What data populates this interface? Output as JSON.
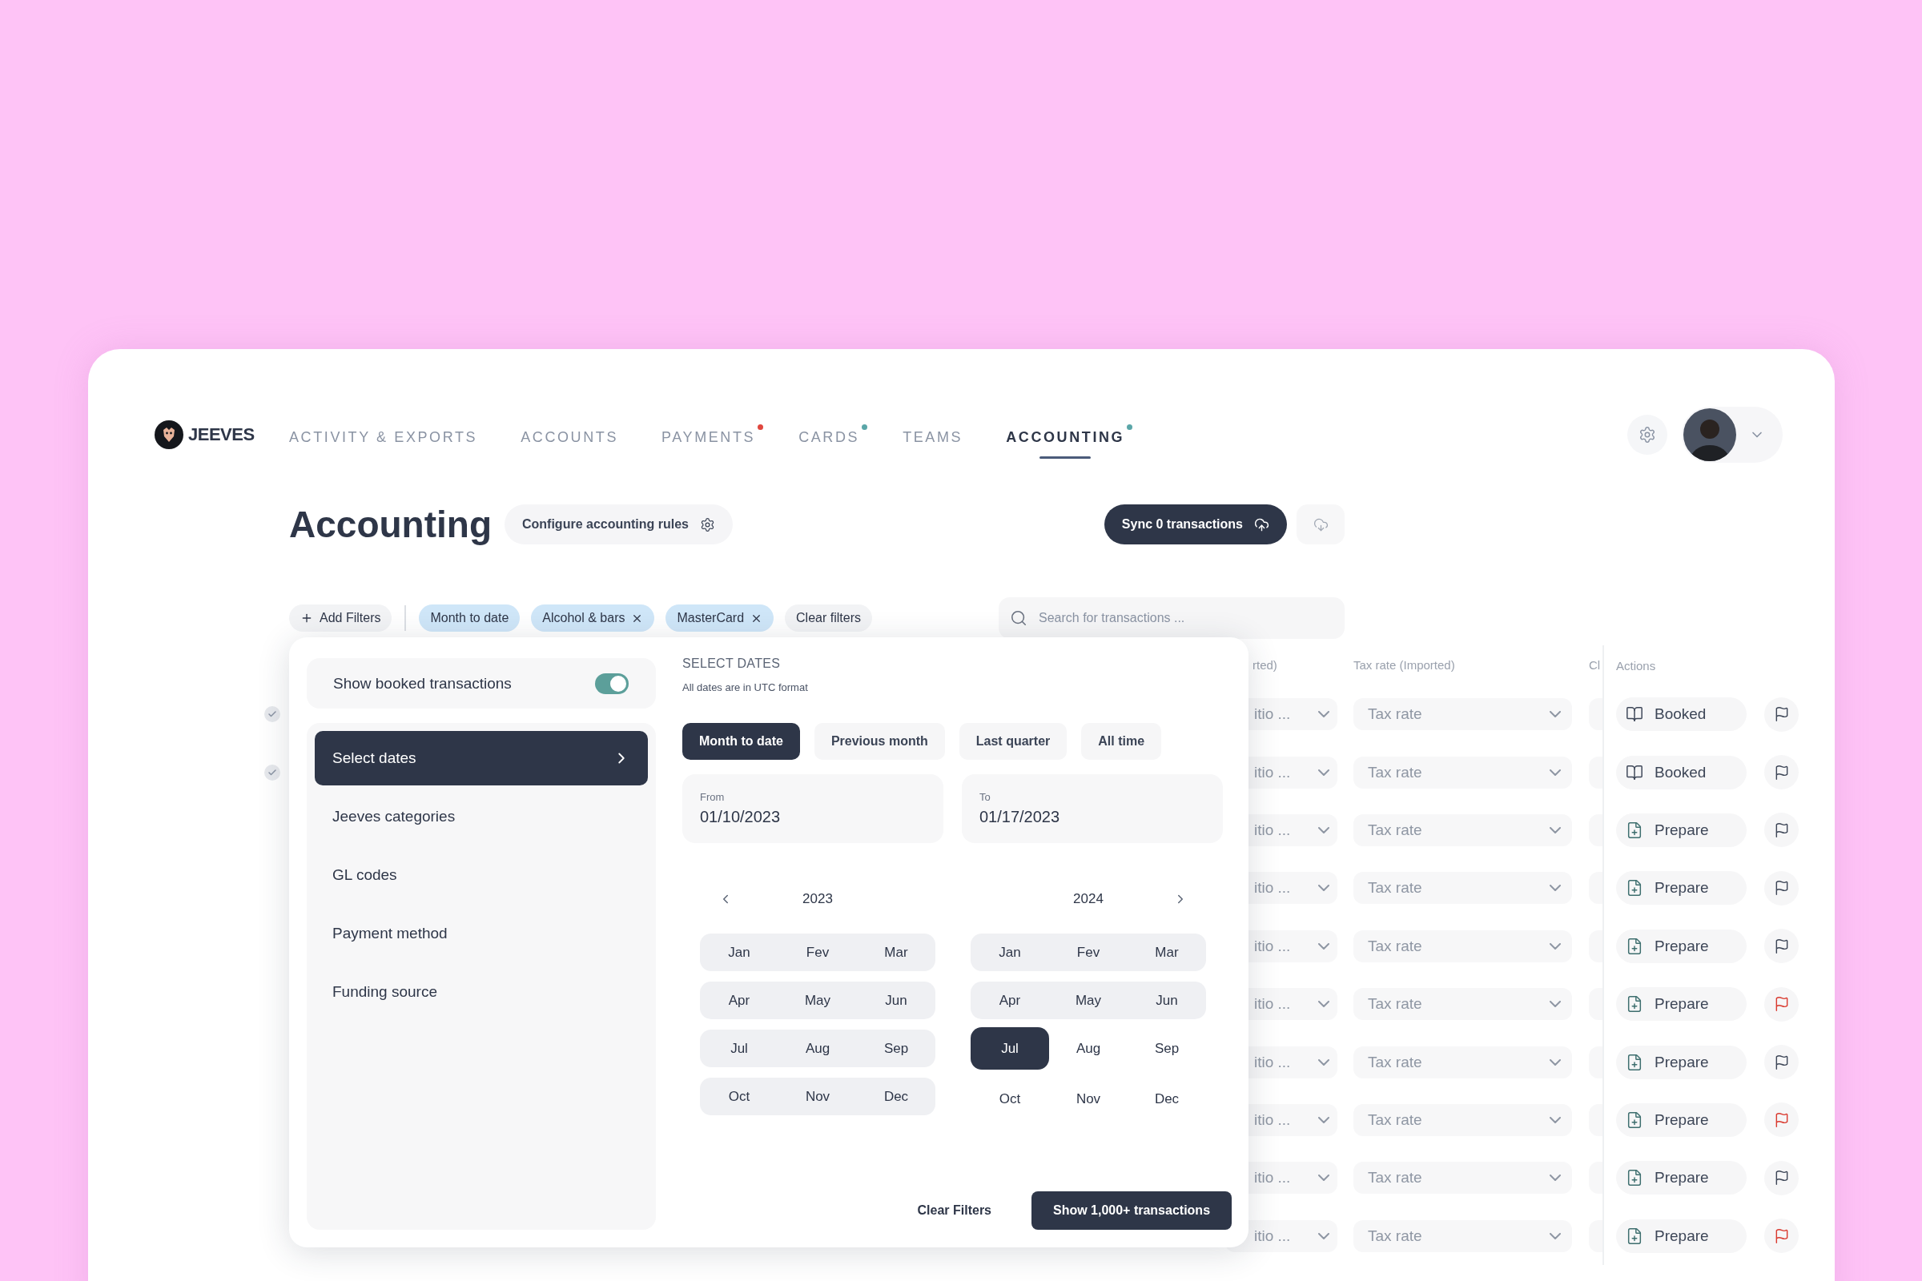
{
  "brand": "JEEVES",
  "nav": [
    {
      "label": "ACTIVITY & EXPORTS",
      "selected": false
    },
    {
      "label": "ACCOUNTS",
      "selected": false
    },
    {
      "label": "PAYMENTS",
      "selected": false,
      "color": "#e0473e"
    },
    {
      "label": "CARDS",
      "selected": false,
      "color": "#5aa6a8"
    },
    {
      "label": "TEAMS",
      "selected": false
    },
    {
      "label": "ACCOUNTING",
      "selected": true,
      "color": "#5aa6a8"
    }
  ],
  "page": {
    "title": "Accounting",
    "configure_button": "Configure accounting rules",
    "sync_button": "Sync 0 transactions"
  },
  "filters": {
    "add_button": "Add Filters",
    "chips": [
      {
        "label": "Month to date",
        "removable": false
      },
      {
        "label": "Alcohol & bars",
        "removable": true
      },
      {
        "label": "MasterCard",
        "removable": true
      }
    ],
    "clear_button": "Clear filters",
    "search": {
      "placeholder": "Search for transactions ..."
    }
  },
  "table": {
    "columns": [
      "rted)",
      "Tax rate (Imported)",
      "Cl",
      "Actions"
    ],
    "rows": [
      {
        "checked": true,
        "column_1": "itio ...",
        "tax_rate": "Tax rate",
        "action": {
          "kind": "booked",
          "label": "Booked"
        },
        "flagged": false
      },
      {
        "checked": true,
        "column_1": "itio ...",
        "tax_rate": "Tax rate",
        "action": {
          "kind": "booked",
          "label": "Booked"
        },
        "flagged": false
      },
      {
        "checked": false,
        "column_1": "itio ...",
        "tax_rate": "Tax rate",
        "action": {
          "kind": "prepare",
          "label": "Prepare"
        },
        "flagged": false
      },
      {
        "checked": false,
        "column_1": "itio ...",
        "tax_rate": "Tax rate",
        "action": {
          "kind": "prepare",
          "label": "Prepare"
        },
        "flagged": false
      },
      {
        "checked": false,
        "column_1": "itio ...",
        "tax_rate": "Tax rate",
        "action": {
          "kind": "prepare",
          "label": "Prepare"
        },
        "flagged": false
      },
      {
        "checked": false,
        "column_1": "itio ...",
        "tax_rate": "Tax rate",
        "action": {
          "kind": "prepare",
          "label": "Prepare"
        },
        "flagged": true
      },
      {
        "checked": false,
        "column_1": "itio ...",
        "tax_rate": "Tax rate",
        "action": {
          "kind": "prepare",
          "label": "Prepare"
        },
        "flagged": false
      },
      {
        "checked": false,
        "column_1": "itio ...",
        "tax_rate": "Tax rate",
        "action": {
          "kind": "prepare",
          "label": "Prepare"
        },
        "flagged": true
      },
      {
        "checked": false,
        "column_1": "itio ...",
        "tax_rate": "Tax rate",
        "action": {
          "kind": "prepare",
          "label": "Prepare"
        },
        "flagged": false
      },
      {
        "checked": false,
        "column_1": "itio ...",
        "tax_rate": "Tax rate",
        "action": {
          "kind": "prepare",
          "label": "Prepare"
        },
        "flagged": true
      }
    ]
  },
  "filter_popup": {
    "toggle": {
      "label": "Show booked transactions",
      "on": true
    },
    "menu": [
      {
        "label": "Select dates",
        "selected": true
      },
      {
        "label": "Jeeves categories",
        "selected": false
      },
      {
        "label": "GL codes",
        "selected": false
      },
      {
        "label": "Payment method",
        "selected": false
      },
      {
        "label": "Funding source",
        "selected": false
      }
    ],
    "title": "SELECT DATES",
    "subtitle": "All dates are in UTC format",
    "presets": [
      {
        "label": "Month to date",
        "selected": true
      },
      {
        "label": "Previous month",
        "selected": false
      },
      {
        "label": "Last quarter",
        "selected": false
      },
      {
        "label": "All time",
        "selected": false
      }
    ],
    "from": {
      "label": "From",
      "value": "01/10/2023"
    },
    "to": {
      "label": "To",
      "value": "01/17/2023"
    },
    "years": [
      {
        "year": "2023",
        "months": [
          {
            "label": "Jan",
            "in_range": true,
            "selected": false
          },
          {
            "label": "Fev",
            "in_range": true,
            "selected": false
          },
          {
            "label": "Mar",
            "in_range": true,
            "selected": false
          },
          {
            "label": "Apr",
            "in_range": true,
            "selected": false
          },
          {
            "label": "May",
            "in_range": true,
            "selected": false
          },
          {
            "label": "Jun",
            "in_range": true,
            "selected": false
          },
          {
            "label": "Jul",
            "in_range": true,
            "selected": false
          },
          {
            "label": "Aug",
            "in_range": true,
            "selected": false
          },
          {
            "label": "Sep",
            "in_range": true,
            "selected": false
          },
          {
            "label": "Oct",
            "in_range": true,
            "selected": false
          },
          {
            "label": "Nov",
            "in_range": true,
            "selected": false
          },
          {
            "label": "Dec",
            "in_range": true,
            "selected": false
          }
        ]
      },
      {
        "year": "2024",
        "months": [
          {
            "label": "Jan",
            "in_range": true,
            "selected": false
          },
          {
            "label": "Fev",
            "in_range": true,
            "selected": false
          },
          {
            "label": "Mar",
            "in_range": true,
            "selected": false
          },
          {
            "label": "Apr",
            "in_range": true,
            "selected": false
          },
          {
            "label": "May",
            "in_range": true,
            "selected": false
          },
          {
            "label": "Jun",
            "in_range": true,
            "selected": false
          },
          {
            "label": "Jul",
            "in_range": false,
            "selected": true
          },
          {
            "label": "Aug",
            "in_range": false,
            "selected": false
          },
          {
            "label": "Sep",
            "in_range": false,
            "selected": false
          },
          {
            "label": "Oct",
            "in_range": false,
            "selected": false
          },
          {
            "label": "Nov",
            "in_range": false,
            "selected": false
          },
          {
            "label": "Dec",
            "in_range": false,
            "selected": false
          }
        ]
      }
    ],
    "clear_button": "Clear Filters",
    "show_button": "Show 1,000+ transactions"
  }
}
